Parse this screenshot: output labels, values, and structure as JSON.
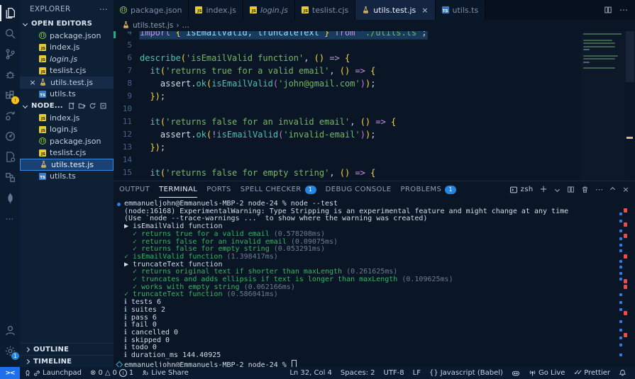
{
  "icons": {
    "ellipsis": "⋯",
    "close": "×",
    "plus": "+",
    "braces": "{}",
    "js_badge": "JS",
    "ts_badge": "TS",
    "check": "✓",
    "arrow_suite": "▶",
    "info_i": "ℹ",
    "error_circle": "⊗",
    "warning_triangle": "△",
    "breadcrumb_sep": "›",
    "breadcrumb_more": "…"
  },
  "sidebar": {
    "title": "EXPLORER",
    "open_editors": {
      "label": "OPEN EDITORS",
      "items": [
        {
          "label": "package.json",
          "icon": "json"
        },
        {
          "label": "index.js",
          "icon": "js"
        },
        {
          "label": "login.js",
          "icon": "js",
          "italic": true
        },
        {
          "label": "teslist.cjs",
          "icon": "js"
        },
        {
          "label": "utils.test.js",
          "icon": "flask",
          "close": true,
          "active": true
        },
        {
          "label": "utils.ts",
          "icon": "ts"
        }
      ]
    },
    "folder": {
      "label": "NODE...",
      "items": [
        {
          "label": "index.js",
          "icon": "js"
        },
        {
          "label": "login.js",
          "icon": "js"
        },
        {
          "label": "package.json",
          "icon": "json"
        },
        {
          "label": "teslist.cjs",
          "icon": "js"
        },
        {
          "label": "utils.test.js",
          "icon": "flask",
          "selected": true
        },
        {
          "label": "utils.ts",
          "icon": "ts"
        }
      ]
    },
    "outline_label": "OUTLINE",
    "timeline_label": "TIMELINE"
  },
  "tabs": [
    {
      "label": "package.json",
      "icon": "json"
    },
    {
      "label": "index.js",
      "icon": "js"
    },
    {
      "label": "login.js",
      "icon": "js",
      "italic": true
    },
    {
      "label": "teslist.cjs",
      "icon": "js"
    },
    {
      "label": "utils.test.js",
      "icon": "flask",
      "active": true,
      "close": true
    },
    {
      "label": "utils.ts",
      "icon": "ts"
    }
  ],
  "breadcrumb": {
    "file": "utils.test.js"
  },
  "editor": {
    "lines": [
      {
        "num": "4",
        "selected": true,
        "mark": "modified",
        "tokens": [
          [
            "kw",
            "import "
          ],
          [
            "p1",
            "{ "
          ],
          [
            "id",
            "isEmailValid"
          ],
          [
            "pu",
            ", "
          ],
          [
            "id",
            "truncateText"
          ],
          [
            "p1",
            " }"
          ],
          [
            "kw",
            " from "
          ],
          [
            "str",
            "'./utils.ts'"
          ],
          [
            "pu",
            ";"
          ]
        ]
      },
      {
        "num": "5",
        "tokens": []
      },
      {
        "num": "6",
        "tokens": [
          [
            "fn",
            "describe"
          ],
          [
            "p1",
            "("
          ],
          [
            "str",
            "'isEmailValid function'"
          ],
          [
            "pu",
            ", "
          ],
          [
            "p1",
            "()"
          ],
          [
            "ar",
            " => "
          ],
          [
            "p1",
            "{"
          ]
        ]
      },
      {
        "num": "7",
        "tokens": [
          [
            "ws",
            "  "
          ],
          [
            "fn",
            "it"
          ],
          [
            "p1",
            "("
          ],
          [
            "str",
            "'returns true for a valid email'"
          ],
          [
            "pu",
            ", "
          ],
          [
            "p1",
            "()"
          ],
          [
            "ar",
            " => "
          ],
          [
            "p1",
            "{"
          ]
        ]
      },
      {
        "num": "8",
        "tokens": [
          [
            "ws",
            "    "
          ],
          [
            "id2",
            "assert"
          ],
          [
            "pu",
            "."
          ],
          [
            "fn",
            "ok"
          ],
          [
            "p1",
            "("
          ],
          [
            "fn",
            "isEmailValid"
          ],
          [
            "p2",
            "("
          ],
          [
            "str",
            "'john@gmail.com'"
          ],
          [
            "p2",
            ")"
          ],
          [
            "p1",
            ")"
          ],
          [
            "pu",
            ";"
          ]
        ]
      },
      {
        "num": "9",
        "tokens": [
          [
            "ws",
            "  "
          ],
          [
            "p1",
            "})"
          ],
          [
            "pu",
            ";"
          ]
        ]
      },
      {
        "num": "10",
        "tokens": []
      },
      {
        "num": "11",
        "tokens": [
          [
            "ws",
            "  "
          ],
          [
            "fn",
            "it"
          ],
          [
            "p1",
            "("
          ],
          [
            "str",
            "'returns false for an invalid email'"
          ],
          [
            "pu",
            ", "
          ],
          [
            "p1",
            "()"
          ],
          [
            "ar",
            " => "
          ],
          [
            "p1",
            "{"
          ]
        ]
      },
      {
        "num": "12",
        "tokens": [
          [
            "ws",
            "    "
          ],
          [
            "id2",
            "assert"
          ],
          [
            "pu",
            "."
          ],
          [
            "fn",
            "ok"
          ],
          [
            "p1",
            "("
          ],
          [
            "bang",
            "!"
          ],
          [
            "fn",
            "isEmailValid"
          ],
          [
            "p2",
            "("
          ],
          [
            "str",
            "'invalid-email'"
          ],
          [
            "p2",
            ")"
          ],
          [
            "p1",
            ")"
          ],
          [
            "pu",
            ";"
          ]
        ]
      },
      {
        "num": "13",
        "tokens": [
          [
            "ws",
            "  "
          ],
          [
            "p1",
            "})"
          ],
          [
            "pu",
            ";"
          ]
        ]
      },
      {
        "num": "14",
        "tokens": []
      },
      {
        "num": "15",
        "tokens": [
          [
            "ws",
            "  "
          ],
          [
            "fn",
            "it"
          ],
          [
            "p1",
            "("
          ],
          [
            "str",
            "'returns false for empty string'"
          ],
          [
            "pu",
            ", "
          ],
          [
            "p1",
            "()"
          ],
          [
            "ar",
            " => "
          ],
          [
            "p1",
            "{"
          ]
        ]
      }
    ]
  },
  "panel": {
    "tabs": [
      {
        "label": "OUTPUT"
      },
      {
        "label": "TERMINAL",
        "active": true
      },
      {
        "label": "PORTS"
      },
      {
        "label": "SPELL CHECKER",
        "badge": "1"
      },
      {
        "label": "DEBUG CONSOLE"
      },
      {
        "label": "PROBLEMS",
        "badge": "1"
      }
    ],
    "shell_label": "zsh",
    "terminal": {
      "lines": [
        {
          "deco": "dot",
          "text": "emmanueljohn@Emmanuels-MBP-2 node-24 % node --test"
        },
        {
          "text": "(node:16168) ExperimentalWarning: Type Stripping is an experimental feature and might change at any time"
        },
        {
          "text": "(Use `node --trace-warnings ...` to show where the warning was created)"
        },
        {
          "icon": "suite",
          "text": "isEmailValid function"
        },
        {
          "indent": 1,
          "icon": "pass",
          "text": "returns true for a valid email",
          "time": "(0.578208ms)"
        },
        {
          "indent": 1,
          "icon": "pass",
          "text": "returns false for an invalid email",
          "time": "(0.09075ms)"
        },
        {
          "indent": 1,
          "icon": "pass",
          "text": "returns false for empty string",
          "time": "(0.053291ms)"
        },
        {
          "icon": "pass",
          "text": "isEmailValid function",
          "time": "(1.398417ms)"
        },
        {
          "icon": "suite",
          "text": "truncateText function"
        },
        {
          "indent": 1,
          "icon": "pass",
          "text": "returns original text if shorter than maxLength",
          "time": "(0.261625ms)"
        },
        {
          "indent": 1,
          "icon": "pass",
          "text": "truncates and adds ellipsis if text is longer than maxLength",
          "time": "(0.109625ms)"
        },
        {
          "indent": 1,
          "icon": "pass",
          "text": "works with empty string",
          "time": "(0.062166ms)"
        },
        {
          "icon": "pass",
          "text": "truncateText function",
          "time": "(0.586041ms)"
        },
        {
          "icon": "info",
          "text": "tests 6"
        },
        {
          "icon": "info",
          "text": "suites 2"
        },
        {
          "icon": "info",
          "text": "pass 6"
        },
        {
          "icon": "info",
          "text": "fail 0"
        },
        {
          "icon": "info",
          "text": "cancelled 0"
        },
        {
          "icon": "info",
          "text": "skipped 0"
        },
        {
          "icon": "info",
          "text": "todo 0"
        },
        {
          "icon": "info",
          "text": "duration_ms 144.40925"
        },
        {
          "deco": "diamond",
          "text": "emmanueljohn@Emmanuels-MBP-2 node-24 % ",
          "cursor": true
        }
      ]
    },
    "scroll_marks": {
      "red": [
        38,
        58,
        74,
        103,
        138,
        146,
        183,
        214
      ],
      "blue": [
        44,
        54,
        68,
        79,
        88,
        96,
        111,
        119,
        128,
        136,
        158,
        169,
        179,
        196,
        208,
        219,
        229,
        243
      ]
    }
  },
  "status_bar": {
    "remote_glyph": "><",
    "launchpad": "Launchpad",
    "errors": "0",
    "warnings": "0",
    "infos": "1",
    "live_share": "Live Share",
    "ln_col": "Ln 32, Col 4",
    "spaces": "Spaces: 2",
    "encoding": "UTF-8",
    "eol": "LF",
    "language_glyph": "{}",
    "language": "Javascript (Babel)",
    "go_live": "Go Live",
    "prettier": "Prettier"
  }
}
